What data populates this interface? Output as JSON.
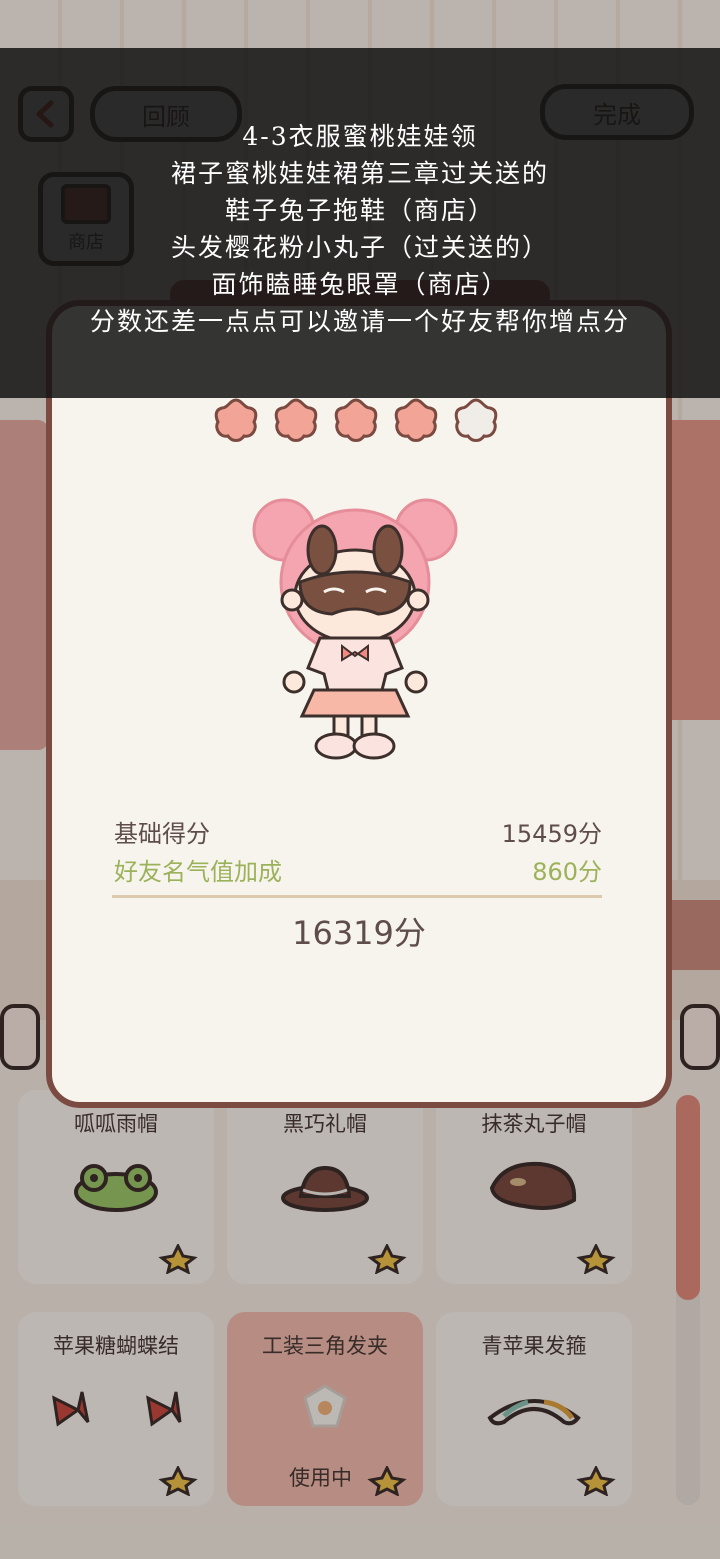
{
  "top_bar": {
    "back_icon": "chevron-left-icon",
    "review_label": "回顾",
    "done_label": "完成",
    "shop_label": "商店"
  },
  "result": {
    "stars_filled": 4,
    "stars_total": 5,
    "base_label": "基础得分",
    "base_value": "15459分",
    "friend_label": "好友名气值加成",
    "friend_value": "860分",
    "total": "16319分",
    "colors": {
      "friend": "#9cb25a",
      "star_filled": "#f2a497",
      "star_empty": "#f0ede8",
      "frame": "#7b4a40"
    }
  },
  "items": [
    {
      "name": "呱呱雨帽",
      "icon": "frog-hat-icon"
    },
    {
      "name": "黑巧礼帽",
      "icon": "brown-hat-icon"
    },
    {
      "name": "抹茶丸子帽",
      "icon": "beret-icon"
    },
    {
      "name": "苹果糖蝴蝶结",
      "icon": "bows-icon"
    },
    {
      "name": "工装三角发夹",
      "icon": "hairclip-icon",
      "in_use": true,
      "in_use_label": "使用中"
    },
    {
      "name": "青苹果发箍",
      "icon": "headband-icon"
    }
  ],
  "caption": [
    "4-3衣服蜜桃娃娃领",
    "裙子蜜桃娃娃裙第三章过关送的",
    "鞋子兔子拖鞋（商店）",
    "头发樱花粉小丸子（过关送的）",
    "面饰瞌睡兔眼罩（商店）",
    "分数还差一点点可以邀请一个好友帮你增点分"
  ]
}
